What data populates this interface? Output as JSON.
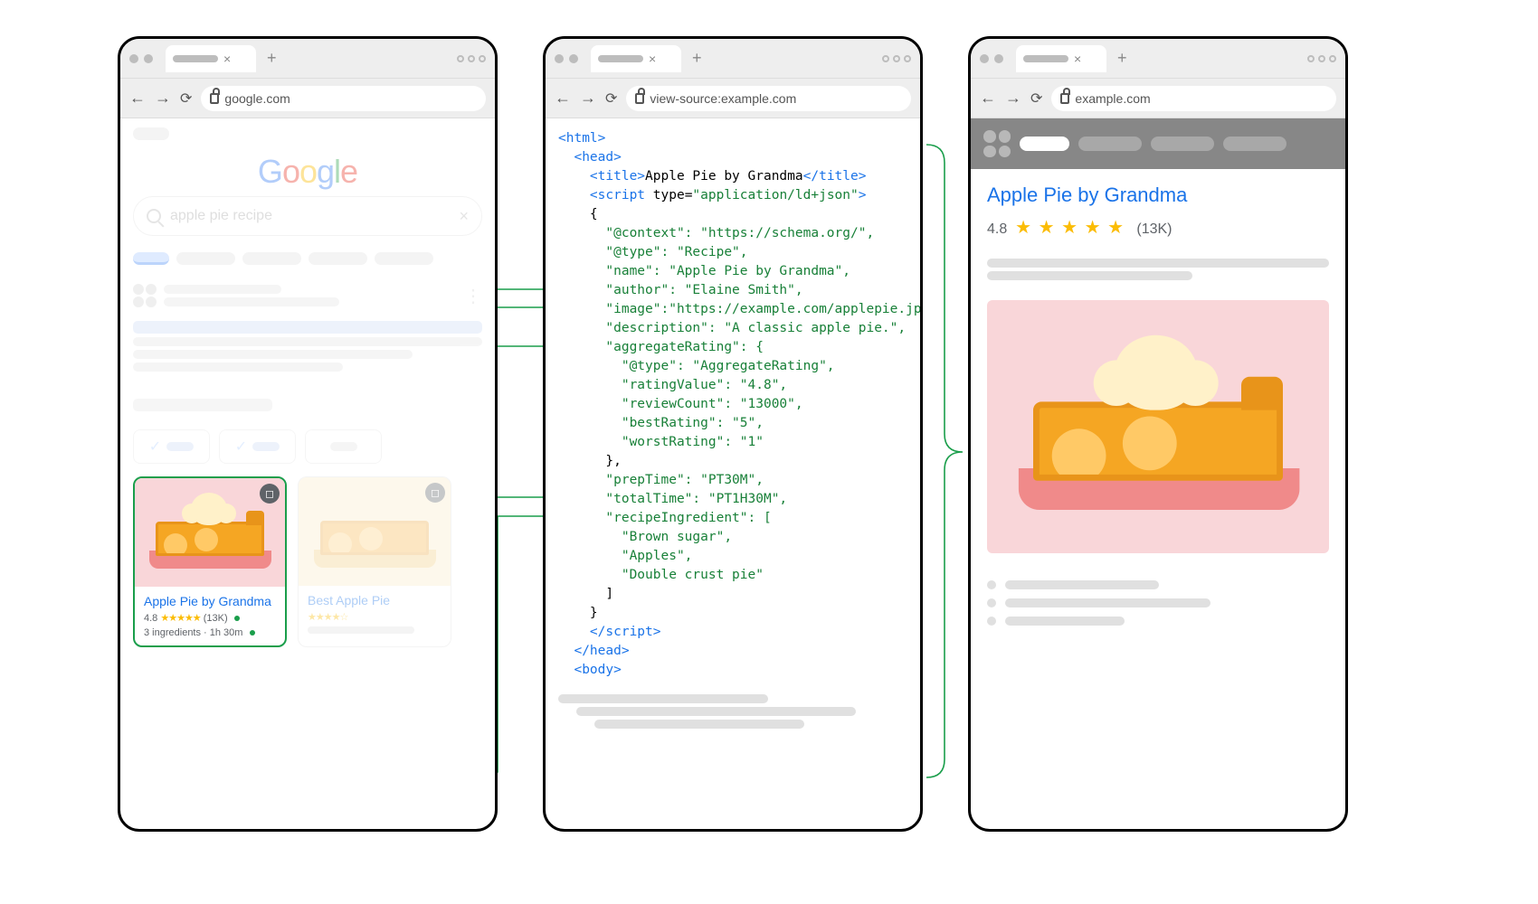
{
  "windows": {
    "search": {
      "url": "google.com",
      "query": "apple pie recipe",
      "logo": "Google"
    },
    "source": {
      "url": "view-source:example.com"
    },
    "site": {
      "url": "example.com"
    }
  },
  "recipe_card": {
    "title": "Apple Pie by Grandma",
    "rating_value": "4.8",
    "stars": "★★★★★",
    "review_count": "(13K)",
    "meta": "3 ingredients · 1h 30m",
    "secondary_title": "Best Apple Pie"
  },
  "source_code": {
    "l1": "<html>",
    "l2": "  <head>",
    "l3_open": "    <title>",
    "l3_txt": "Apple Pie by Grandma",
    "l3_close": "</title>",
    "l4_open": "    <script ",
    "l4_attr": "type",
    "l4_eq": "=",
    "l4_val": "\"application/ld+json\"",
    "l4_close": ">",
    "l5": "    {",
    "l6": "      \"@context\": \"https://schema.org/\",",
    "l7": "      \"@type\": \"Recipe\",",
    "l8": "      \"name\": \"Apple Pie by Grandma\",",
    "l9": "      \"author\": \"Elaine Smith\",",
    "l10": "      \"image\":\"https://example.com/applepie.jpg\",",
    "l11": "      \"description\": \"A classic apple pie.\",",
    "l12": "      \"aggregateRating\": {",
    "l13": "        \"@type\": \"AggregateRating\",",
    "l14": "        \"ratingValue\": \"4.8\",",
    "l15": "        \"reviewCount\": \"13000\",",
    "l16": "        \"bestRating\": \"5\",",
    "l17": "        \"worstRating\": \"1\"",
    "l18": "      },",
    "l19": "      \"prepTime\": \"PT30M\",",
    "l20": "      \"totalTime\": \"PT1H30M\",",
    "l21": "      \"recipeIngredient\": [",
    "l22": "        \"Brown sugar\",",
    "l23": "        \"Apples\",",
    "l24": "        \"Double crust pie\"",
    "l25": "      ]",
    "l26": "    }",
    "l27_close": "    </script>",
    "l28": "  </head>",
    "l29": "  <body>"
  },
  "site_page": {
    "title": "Apple Pie by Grandma",
    "rating_value": "4.8",
    "stars": "★ ★ ★ ★ ★",
    "review_count": "(13K)"
  }
}
